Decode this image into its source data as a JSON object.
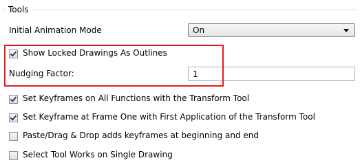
{
  "group": {
    "title": "Tools"
  },
  "animation_mode": {
    "label": "Initial Animation Mode",
    "value": "On"
  },
  "show_locked": {
    "label": "Show Locked Drawings As Outlines",
    "checked": true
  },
  "nudging": {
    "label": "Nudging Factor:",
    "value": "1"
  },
  "checkboxes": [
    {
      "label": "Set Keyframes on All Functions with the Transform Tool",
      "checked": true
    },
    {
      "label": "Set Keyframe at Frame One with First Application of the Transform Tool",
      "checked": true
    },
    {
      "label": "Paste/Drag & Drop adds keyframes at beginning and end",
      "checked": false
    },
    {
      "label": "Select Tool Works on Single Drawing",
      "checked": false
    }
  ],
  "colors": {
    "highlight": "#e31b23",
    "check": "#2b3f6e"
  }
}
